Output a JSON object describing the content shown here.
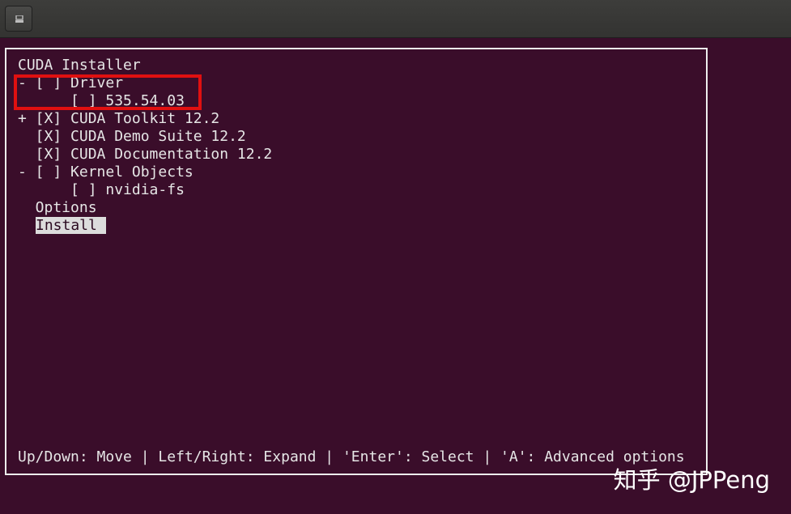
{
  "titlebar": {
    "button_icon": "terminal-menu-icon"
  },
  "installer": {
    "title": "CUDA Installer",
    "lines": [
      "- [ ] Driver",
      "      [ ] 535.54.03",
      "+ [X] CUDA Toolkit 12.2",
      "  [X] CUDA Demo Suite 12.2",
      "  [X] CUDA Documentation 12.2",
      "- [ ] Kernel Objects",
      "      [ ] nvidia-fs",
      "  Options"
    ],
    "install_label": "Install ",
    "help": "Up/Down: Move | Left/Right: Expand | 'Enter': Select | 'A': Advanced options"
  },
  "watermark": "知乎 @JPPeng",
  "colors": {
    "background": "#3a0d2a",
    "text": "#e6e6e6",
    "highlight_bg": "#dcdcdc",
    "annotation_box": "#e01010"
  }
}
